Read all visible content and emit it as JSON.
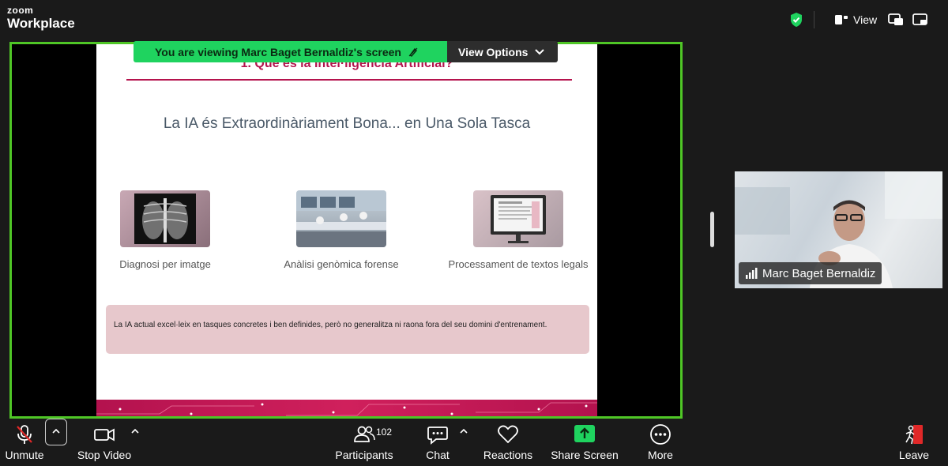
{
  "app": {
    "brand_top": "zoom",
    "brand_bottom": "Workplace"
  },
  "topbar": {
    "view_label": "View"
  },
  "banner": {
    "viewing_text": "You are viewing  Marc Baget Bernaldiz's screen",
    "options_label": "View Options"
  },
  "slide": {
    "heading": "1. Què és la Intel·ligència Artificial?",
    "title": "La IA és Extraordinàriament Bona... en Una Sola Tasca",
    "cards": [
      {
        "caption": "Diagnosi per imatge"
      },
      {
        "caption": "Anàlisi genòmica forense"
      },
      {
        "caption": "Processament de textos legals"
      }
    ],
    "note": "La IA actual excel·leix en tasques concretes i ben definides, però no generalitza ni raona fora del seu domini d'entrenament."
  },
  "participant": {
    "name": "Marc Baget Bernaldiz"
  },
  "toolbar": {
    "unmute": "Unmute",
    "stop_video": "Stop Video",
    "participants": "Participants",
    "participants_count": "102",
    "chat": "Chat",
    "reactions": "Reactions",
    "share_screen": "Share Screen",
    "more": "More",
    "leave": "Leave"
  },
  "colors": {
    "accent_green": "#1fd35f",
    "frame_green": "#4fc626",
    "slide_accent": "#b5134d",
    "leave_red": "#e02828"
  }
}
